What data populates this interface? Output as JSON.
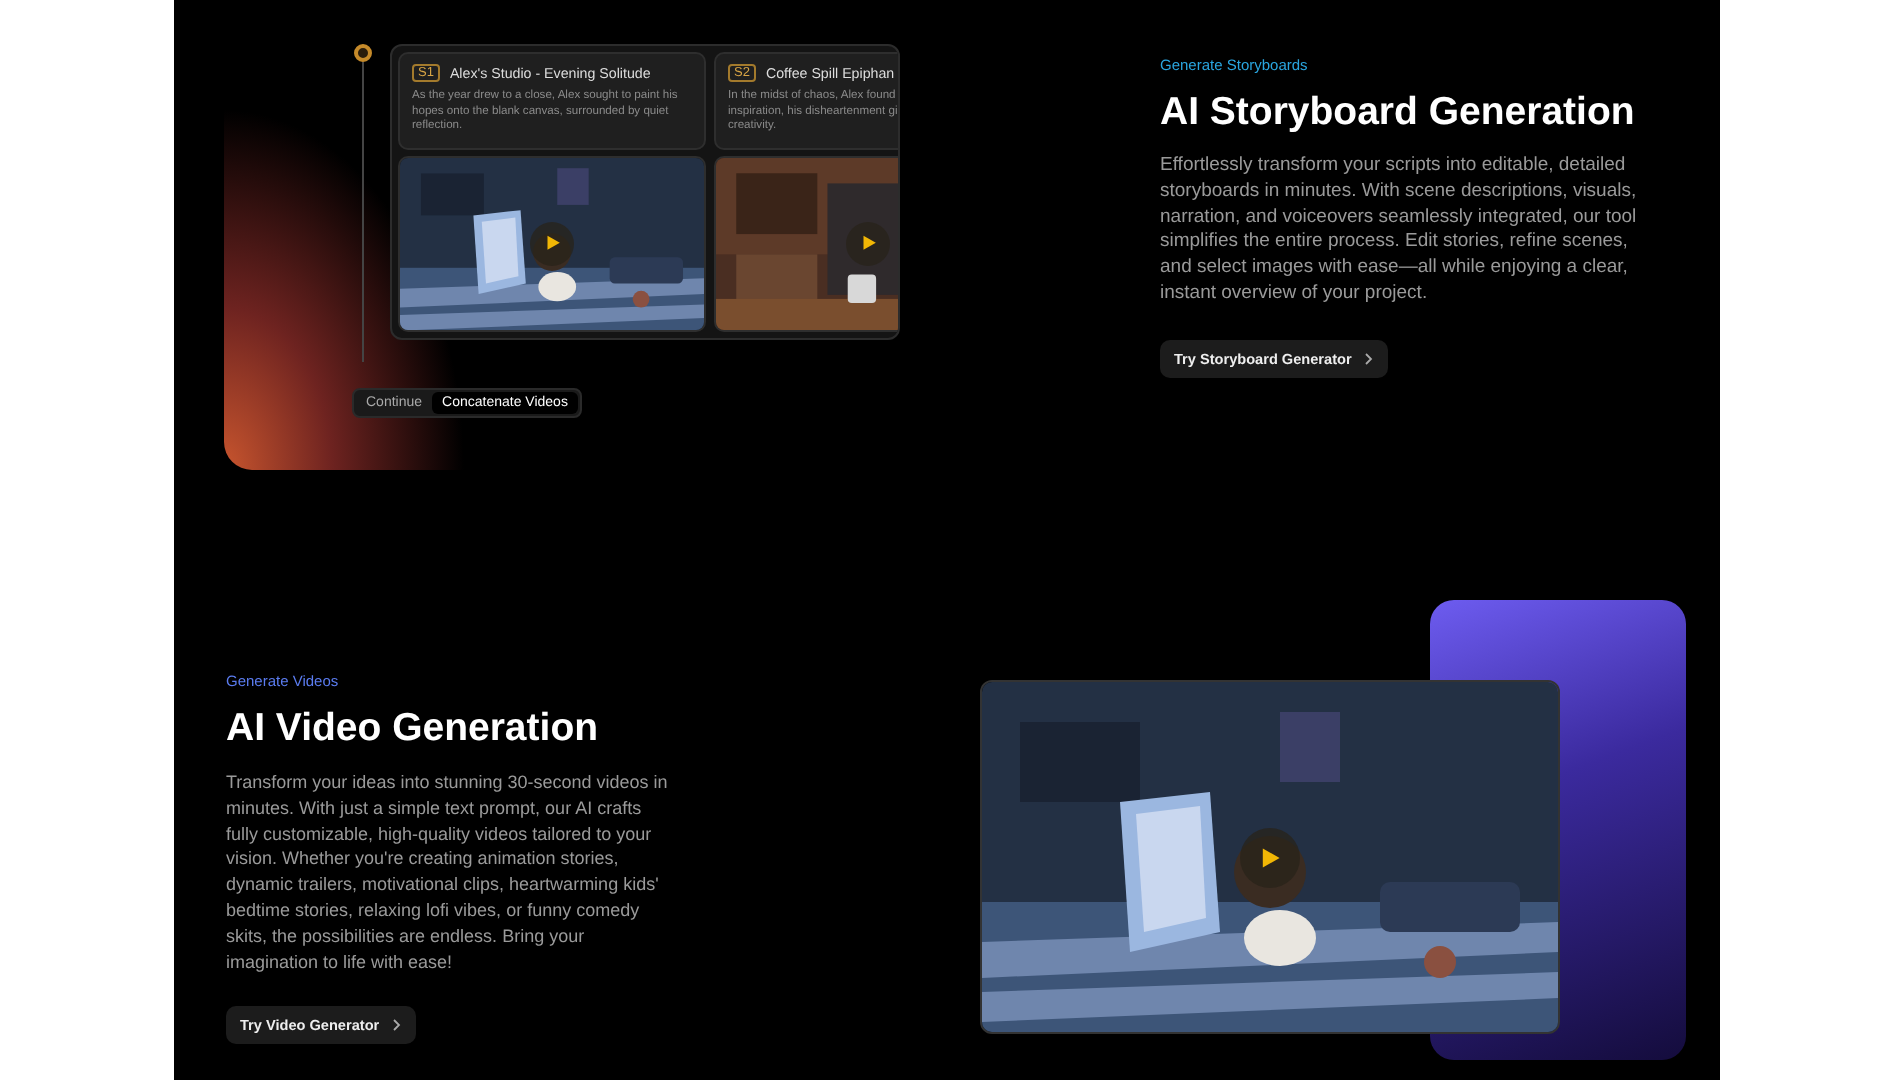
{
  "storyboard_demo": {
    "scenes": [
      {
        "badge": "S1",
        "title": "Alex's Studio - Evening Solitude",
        "description_lines": [
          "As the year drew to a close, Alex sought to paint his",
          "hopes onto the blank canvas, surrounded by quiet",
          "reflection."
        ]
      },
      {
        "badge": "S2",
        "title": "Coffee Spill Epiphan",
        "description_lines": [
          "In the midst of chaos, Alex found",
          "inspiration, his disheartenment gi",
          "creativity."
        ]
      }
    ],
    "buttons": [
      {
        "label": "Continue",
        "selected": false
      },
      {
        "label": "Concatenate Videos",
        "selected": true
      }
    ]
  },
  "storyboards": {
    "eyebrow": "Generate Storyboards",
    "title": "AI Storyboard Generation",
    "body": "Effortlessly transform your scripts into editable, detailed storyboards in minutes. With scene descriptions, visuals, narration, and voiceovers seamlessly integrated, our tool simplifies the entire process. Edit stories, refine scenes, and select images with ease—all while enjoying a clear, instant overview of your project.",
    "cta": "Try Storyboard Generator"
  },
  "videos": {
    "eyebrow": "Generate Videos",
    "title": "AI Video Generation",
    "body": "Transform your ideas into stunning 30-second videos in minutes. With just a simple text prompt, our AI crafts fully customizable, high-quality videos tailored to your vision. Whether you're creating animation stories, dynamic trailers, motivational clips, heartwarming kids' bedtime stories, relaxing lofi vibes, or funny comedy skits, the possibilities are endless. Bring your imagination to life with ease!",
    "cta": "Try Video Generator"
  }
}
